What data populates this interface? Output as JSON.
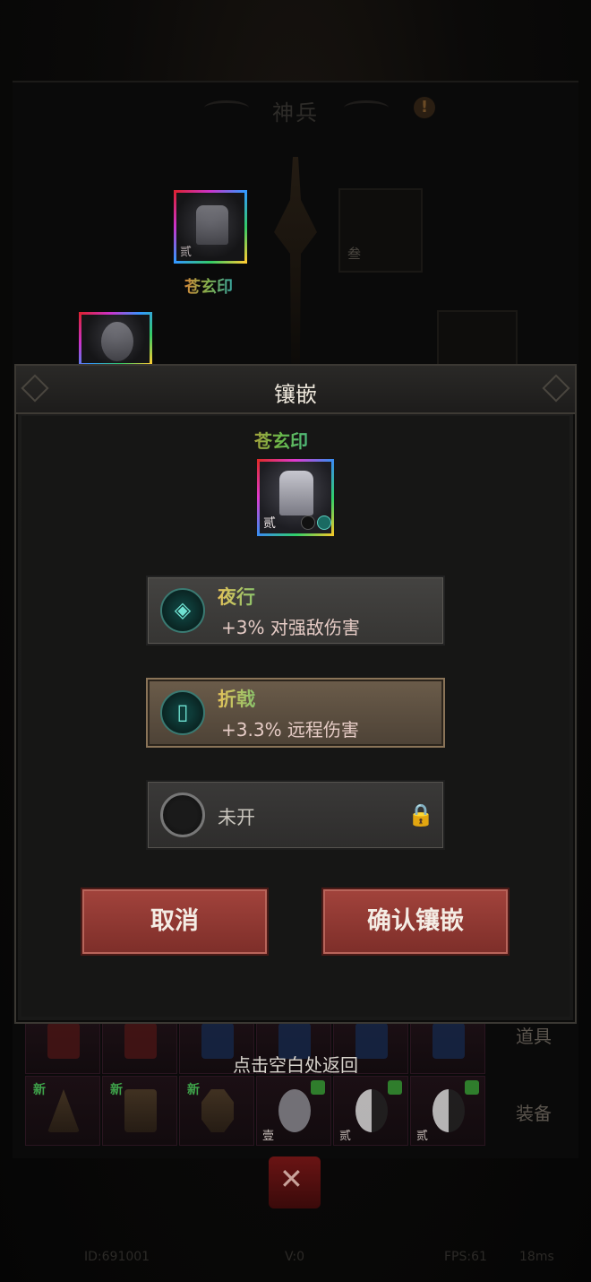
{
  "background": {
    "screen_title": "神兵",
    "info_icon": "exclamation-icon",
    "slot_label_3": "叁",
    "equipped_item": {
      "name": "苍玄印",
      "tier": "贰"
    },
    "inventory": {
      "row2": [
        {
          "tag": "新",
          "tier": ""
        },
        {
          "tag": "新",
          "tier": ""
        },
        {
          "tag": "新",
          "tier": ""
        },
        {
          "tag": "",
          "tier": "壹"
        },
        {
          "tag": "",
          "tier": "贰"
        },
        {
          "tag": "",
          "tier": "贰"
        }
      ],
      "side_tabs": [
        "道具",
        "装备"
      ]
    },
    "footer": {
      "id": "ID:691001",
      "version": "V:0",
      "fps": "FPS:61",
      "latency": "18ms"
    }
  },
  "modal": {
    "title": "镶嵌",
    "item": {
      "name": "苍玄印",
      "tier": "贰"
    },
    "gems": [
      {
        "name": "夜行",
        "effect": "+3% 对强敌伤害",
        "state": "plain",
        "icon": "night-rune-icon"
      },
      {
        "name": "折戟",
        "effect": "+3.3% 远程伤害",
        "state": "selected",
        "icon": "broken-halberd-rune-icon"
      }
    ],
    "locked_slot": {
      "label": "未开",
      "icon": "lock-icon"
    },
    "cancel_label": "取消",
    "confirm_label": "确认镶嵌"
  },
  "hint": "点击空白处返回"
}
